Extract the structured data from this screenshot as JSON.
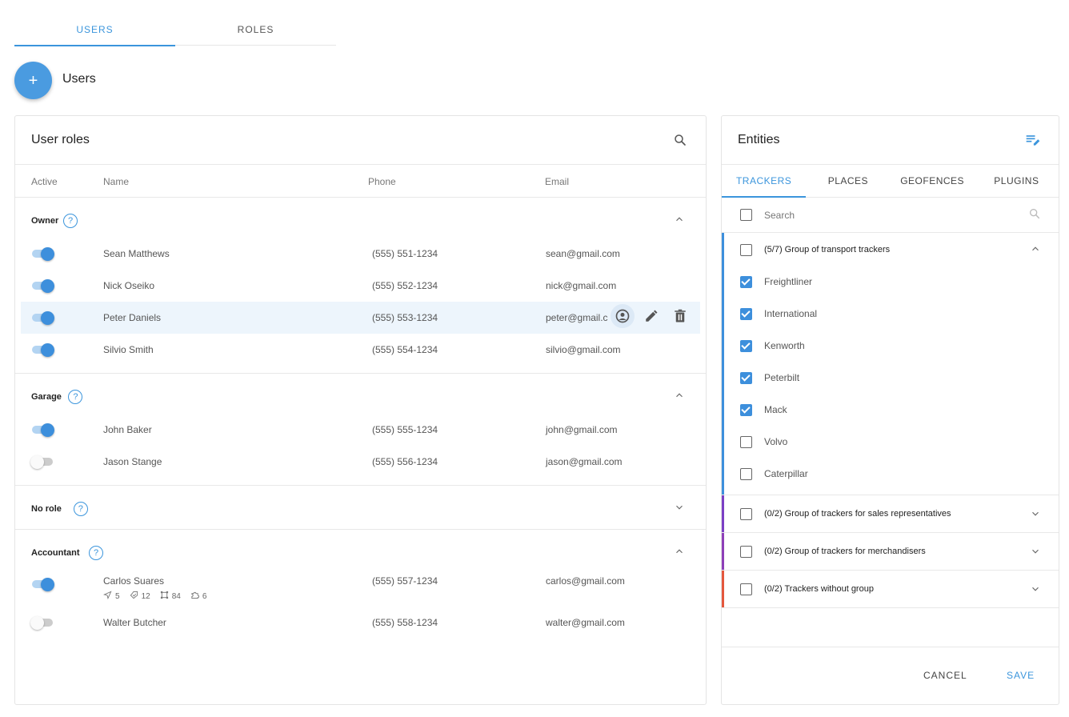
{
  "top_tabs": [
    {
      "label": "USERS",
      "active": true
    },
    {
      "label": "ROLES",
      "active": false
    }
  ],
  "fab": {
    "icon": "plus-icon",
    "label": "+"
  },
  "page_title": "Users",
  "roles_card": {
    "title": "User roles",
    "search_icon": "search-icon",
    "columns": {
      "active": "Active",
      "name": "Name",
      "phone": "Phone",
      "email": "Email"
    },
    "sections": [
      {
        "name": "Owner",
        "expanded": true,
        "users": [
          {
            "name": "Sean Matthews",
            "phone": "(555) 551-1234",
            "email": "sean@gmail.com",
            "active": true
          },
          {
            "name": "Nick Oseiko",
            "phone": "(555) 552-1234",
            "email": "nick@gmail.com",
            "active": true
          },
          {
            "name": "Peter Daniels",
            "phone": "(555) 553-1234",
            "email": "peter@gmail.c",
            "active": true
          },
          {
            "name": "Silvio Smith",
            "phone": "(555) 554-1234",
            "email": "silvio@gmail.com",
            "active": true
          }
        ]
      },
      {
        "name": "Garage",
        "expanded": true,
        "users": [
          {
            "name": "John Baker",
            "phone": "(555) 555-1234",
            "email": "john@gmail.com",
            "active": true
          },
          {
            "name": "Jason Stange",
            "phone": "(555) 556-1234",
            "email": "jason@gmail.com",
            "active": false
          }
        ]
      },
      {
        "name": "No role",
        "expanded": false,
        "users": []
      },
      {
        "name": "Accountant",
        "expanded": true,
        "users": [
          {
            "name": "Carlos Suares",
            "phone": "(555) 557-1234",
            "email": "carlos@gmail.com",
            "active": true
          },
          {
            "name": "Walter Butcher",
            "phone": "(555) 558-1234",
            "email": "walter@gmail.com",
            "active": false
          }
        ]
      }
    ],
    "stats": [
      {
        "icon": "navigation-icon",
        "value": "5"
      },
      {
        "icon": "tag-check-icon",
        "value": "12"
      },
      {
        "icon": "geofence-icon",
        "value": "84"
      },
      {
        "icon": "plugin-icon",
        "value": "6"
      }
    ]
  },
  "entities_card": {
    "title": "Entities",
    "edit_icon": "list-edit-icon",
    "tabs": [
      {
        "label": "TRACKERS",
        "active": true
      },
      {
        "label": "PLACES",
        "active": false
      },
      {
        "label": "GEOFENCES",
        "active": false
      },
      {
        "label": "PLUGINS",
        "active": false
      }
    ],
    "search_placeholder": "Search",
    "groups": [
      {
        "title": "(5/7) Group of transport trackers",
        "color": "#3d8fdc",
        "expanded": true,
        "items": [
          {
            "label": "Freightliner",
            "checked": true
          },
          {
            "label": "International",
            "checked": true
          },
          {
            "label": "Kenworth",
            "checked": true
          },
          {
            "label": "Peterbilt",
            "checked": true
          },
          {
            "label": "Mack",
            "checked": true
          },
          {
            "label": "Volvo",
            "checked": false
          },
          {
            "label": "Caterpillar",
            "checked": false
          }
        ]
      },
      {
        "title": "(0/2) Group of trackers for sales representatives",
        "color": "#7b3fc4",
        "expanded": false,
        "items": []
      },
      {
        "title": "(0/2) Group of trackers for merchandisers",
        "color": "#8e3fb8",
        "expanded": false,
        "items": []
      },
      {
        "title": "(0/2) Trackers without group",
        "color": "#e4573d",
        "expanded": false,
        "items": []
      }
    ],
    "cancel_label": "CANCEL",
    "save_label": "SAVE"
  },
  "colors": {
    "accent": "#3b95dc",
    "toggle_on": "#3d8fdc"
  }
}
